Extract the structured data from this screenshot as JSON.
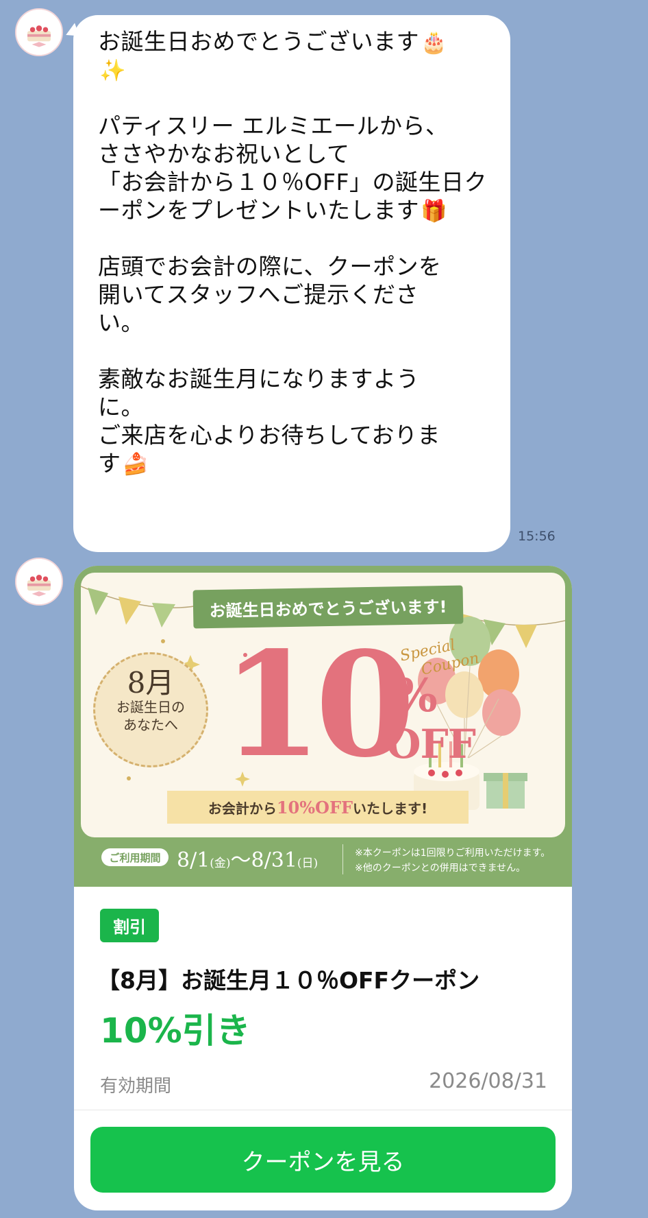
{
  "message": {
    "lines": [
      "お誕生日おめでとうございます",
      "",
      "",
      "パティスリー エルミエールから、",
      "ささやかなお祝いとして",
      "「お会計から１０％OFF」の誕生日ク",
      "ーポンをプレゼントいたします",
      "",
      "店頭でお会計の際に、クーポンを",
      "開いてスタッフへご提示くださ",
      "い。",
      "",
      "素敵なお誕生月になりますよう",
      "に。",
      "ご来店を心よりお待ちしておりま",
      "す"
    ],
    "emoji_cake": "🎂",
    "emoji_sparkles": "✨",
    "emoji_gift": "🎁",
    "emoji_shortcake": "🍰",
    "time": "15:56"
  },
  "banner": {
    "ribbon_text": "お誕生日おめでとうございます!",
    "month": "8月",
    "month_line1": "お誕生日の",
    "month_line2": "あなたへ",
    "big_number": "10",
    "percent": "%",
    "off": "OFF",
    "special_line1": "Special",
    "special_line2": "Coupon",
    "strip_pre": "お会計から",
    "strip_value": "10%OFF",
    "strip_post": "いたします!",
    "period_label": "ご利用期間",
    "period_start": "8/1",
    "period_start_day": "(金)",
    "period_tilde": "〜",
    "period_end": "8/31",
    "period_end_day": "(日)",
    "note1": "※本クーポンは1回限りご利用いただけます。",
    "note2": "※他のクーポンとの併用はできません。"
  },
  "coupon": {
    "tag": "割引",
    "title": "【8月】お誕生月１０％OFFクーポン",
    "discount": "10%引き",
    "validity_label": "有効期間",
    "validity_date": "2026/08/31",
    "button_label": "クーポンを見る"
  },
  "colors": {
    "background": "#8FAACF",
    "accent_green": "#16C24D",
    "banner_green": "#87AE6C",
    "banner_pink": "#E3727D"
  }
}
